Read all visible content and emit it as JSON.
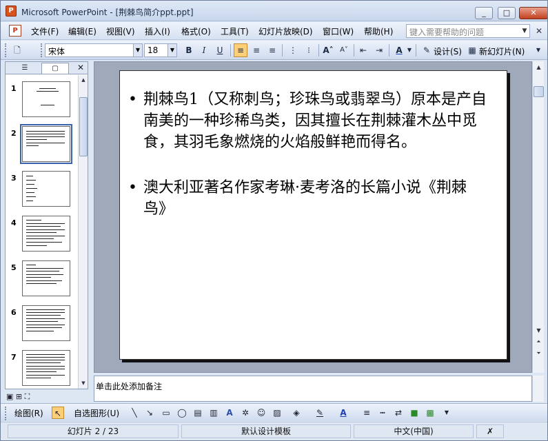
{
  "window": {
    "title": "Microsoft PowerPoint - [荆棘鸟简介ppt.ppt]",
    "app_icon": "P",
    "buttons": [
      "_",
      "□",
      "✕"
    ]
  },
  "menu": {
    "items": [
      "文件(F)",
      "编辑(E)",
      "视图(V)",
      "插入(I)",
      "格式(O)",
      "工具(T)",
      "幻灯片放映(D)",
      "窗口(W)",
      "帮助(H)"
    ],
    "help_placeholder": "键入需要帮助的问题",
    "close": "✕"
  },
  "toolbar": {
    "font_name": "宋体",
    "font_size": "18",
    "bold": "B",
    "italic": "I",
    "underline": "U",
    "design_label": "设计(S)",
    "new_slide_label": "新幻灯片(N)"
  },
  "panel": {
    "tab_outline": "☰",
    "tab_slides": "▢",
    "close": "✕",
    "slide_numbers": [
      "1",
      "2",
      "3",
      "4",
      "5",
      "6",
      "7"
    ],
    "selected_slide": 2
  },
  "slide": {
    "bullets": [
      "荆棘鸟1（又称刺鸟；珍珠鸟或翡翠鸟）原本是产自南美的一种珍稀鸟类，因其擅长在荆棘灌木丛中觅食，其羽毛象燃烧的火焰般鲜艳而得名。",
      "澳大利亚著名作家考琳·麦考洛的长篇小说《荆棘鸟》"
    ],
    "bullet_symbol": "•"
  },
  "notes": {
    "placeholder": "单击此处添加备注"
  },
  "drawing": {
    "draw_label": "绘图(R)",
    "autoshape_label": "自选图形(U)"
  },
  "status": {
    "slide_position": "幻灯片 2 / 23",
    "template": "默认设计模板",
    "language": "中文(中国)"
  },
  "colors": {
    "accent_orange": "#d9531e",
    "selection_blue": "#3a63ad"
  }
}
